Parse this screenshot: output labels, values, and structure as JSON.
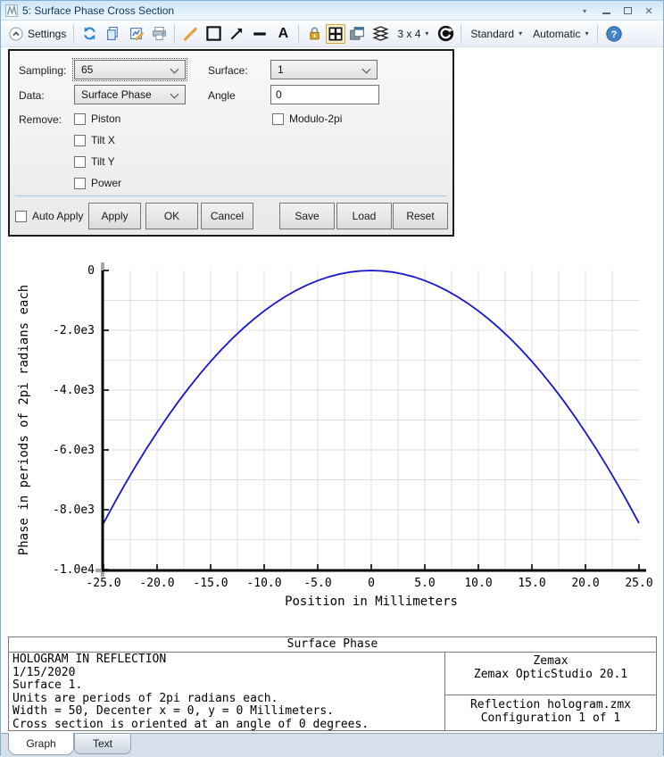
{
  "window": {
    "title": "5: Surface Phase Cross Section"
  },
  "icons": {
    "menu_caret": "▾",
    "caret": "▾",
    "close": "✕",
    "text_tool": "A",
    "help": "?"
  },
  "toolbar": {
    "settings_label": "Settings",
    "grid_size": "3 x 4",
    "standard_label": "Standard",
    "automatic_label": "Automatic"
  },
  "settings": {
    "sampling_label": "Sampling:",
    "sampling_value": "65",
    "surface_label": "Surface:",
    "surface_value": "1",
    "data_label": "Data:",
    "data_value": "Surface Phase",
    "angle_label": "Angle",
    "angle_value": "0",
    "remove_label": "Remove:",
    "checkboxes": {
      "piston": "Piston",
      "modulo": "Modulo-2pi",
      "tiltx": "Tilt X",
      "tilty": "Tilt Y",
      "power": "Power"
    },
    "auto_apply_label": "Auto Apply",
    "buttons": [
      "Apply",
      "OK",
      "Cancel",
      "Save",
      "Load",
      "Reset"
    ]
  },
  "chart_data": {
    "type": "line",
    "title": "",
    "xlabel": "Position in Millimeters",
    "ylabel": "Phase in periods of 2pi radians each",
    "xlim": [
      -25,
      25
    ],
    "ylim": [
      -10000,
      0
    ],
    "grid": true,
    "grid_color": "#dedede",
    "x_minor_step": 2.5,
    "y_minor_step": 1000,
    "x_ticks": [
      -25,
      -20,
      -15,
      -10,
      -5,
      0,
      5,
      10,
      15,
      20,
      25
    ],
    "x_tick_labels": [
      "-25.0",
      "-20.0",
      "-15.0",
      "-10.0",
      "-5.0",
      "0",
      "5.0",
      "10.0",
      "15.0",
      "20.0",
      "25.0"
    ],
    "y_ticks": [
      0,
      -2000,
      -4000,
      -6000,
      -8000,
      -10000
    ],
    "y_tick_labels": [
      "0",
      "-2.0e3",
      "-4.0e3",
      "-6.0e3",
      "-8.0e3",
      "-1.0e4"
    ],
    "legend_position": "none",
    "series": [
      {
        "name": "Surface Phase",
        "color": "#1515cf",
        "x": [
          -25,
          -24,
          -23,
          -22,
          -21,
          -20,
          -19,
          -18,
          -17,
          -16,
          -15,
          -14,
          -13,
          -12,
          -11,
          -10,
          -9,
          -8,
          -7,
          -6,
          -5,
          -4,
          -3,
          -2,
          -1,
          0,
          1,
          2,
          3,
          4,
          5,
          6,
          7,
          8,
          9,
          10,
          11,
          12,
          13,
          14,
          15,
          16,
          17,
          18,
          19,
          20,
          21,
          22,
          23,
          24,
          25
        ],
        "y": [
          -8450,
          -7787.5,
          -7152.1,
          -6543.7,
          -5962.3,
          -5408,
          -4880.7,
          -4380.5,
          -3907.3,
          -3461.1,
          -3042,
          -2649.9,
          -2284.9,
          -1946.9,
          -1635.9,
          -1352,
          -1095.1,
          -865.3,
          -662.5,
          -486.7,
          -338,
          -216.3,
          -121.7,
          -54.1,
          -13.5,
          0,
          -13.5,
          -54.1,
          -121.7,
          -216.3,
          -338,
          -486.7,
          -662.5,
          -865.3,
          -1095.1,
          -1352,
          -1635.9,
          -1946.9,
          -2284.9,
          -2649.9,
          -3042,
          -3461.1,
          -3907.3,
          -4380.5,
          -4880.7,
          -5408,
          -5962.3,
          -6543.7,
          -7152.1,
          -7787.5,
          -8450
        ]
      }
    ]
  },
  "footer": {
    "title": "Surface Phase",
    "left_lines": [
      "HOLOGRAM IN REFLECTION",
      "1/15/2020",
      "Surface 1.",
      "Units are periods of 2pi radians each.",
      "Width = 50, Decenter x = 0, y = 0 Millimeters.",
      "Cross section is oriented at an angle of 0 degrees."
    ],
    "right_top": [
      "Zemax",
      "Zemax OpticStudio 20.1"
    ],
    "right_bottom": [
      "Reflection hologram.zmx",
      "Configuration 1 of 1"
    ]
  },
  "tabs": [
    {
      "label": "Graph",
      "active": true
    },
    {
      "label": "Text",
      "active": false
    }
  ]
}
